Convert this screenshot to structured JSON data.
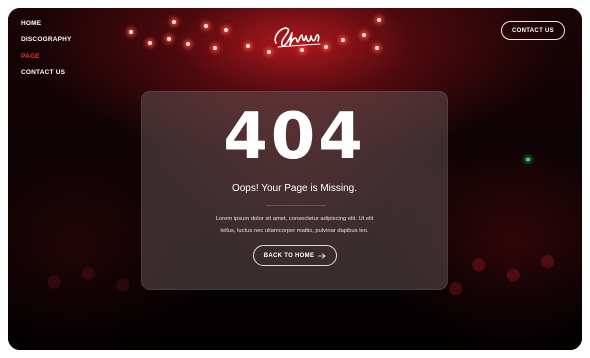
{
  "nav": {
    "items": [
      {
        "label": "HOME",
        "active": false
      },
      {
        "label": "DISCOGRAPHY",
        "active": false
      },
      {
        "label": "PAGE",
        "active": true
      },
      {
        "label": "CONTACT US",
        "active": false
      }
    ]
  },
  "header": {
    "logo_text": "Sinatra",
    "contact_button": "CONTACT US"
  },
  "error": {
    "code": "404",
    "headline": "Oops! Your Page is Missing.",
    "body_line1": "Lorem ipsum dolor sit amet, consectetur adipiscing elit. Ut elit",
    "body_line2": "tellus, luctus nec ullamcorper mattis, pulvinar dapibus leo.",
    "back_button": "BACK TO HOME",
    "back_icon": "arrow-right-icon"
  },
  "colors": {
    "accent": "#e8342f",
    "text": "#ffffff",
    "background": "#060203"
  }
}
